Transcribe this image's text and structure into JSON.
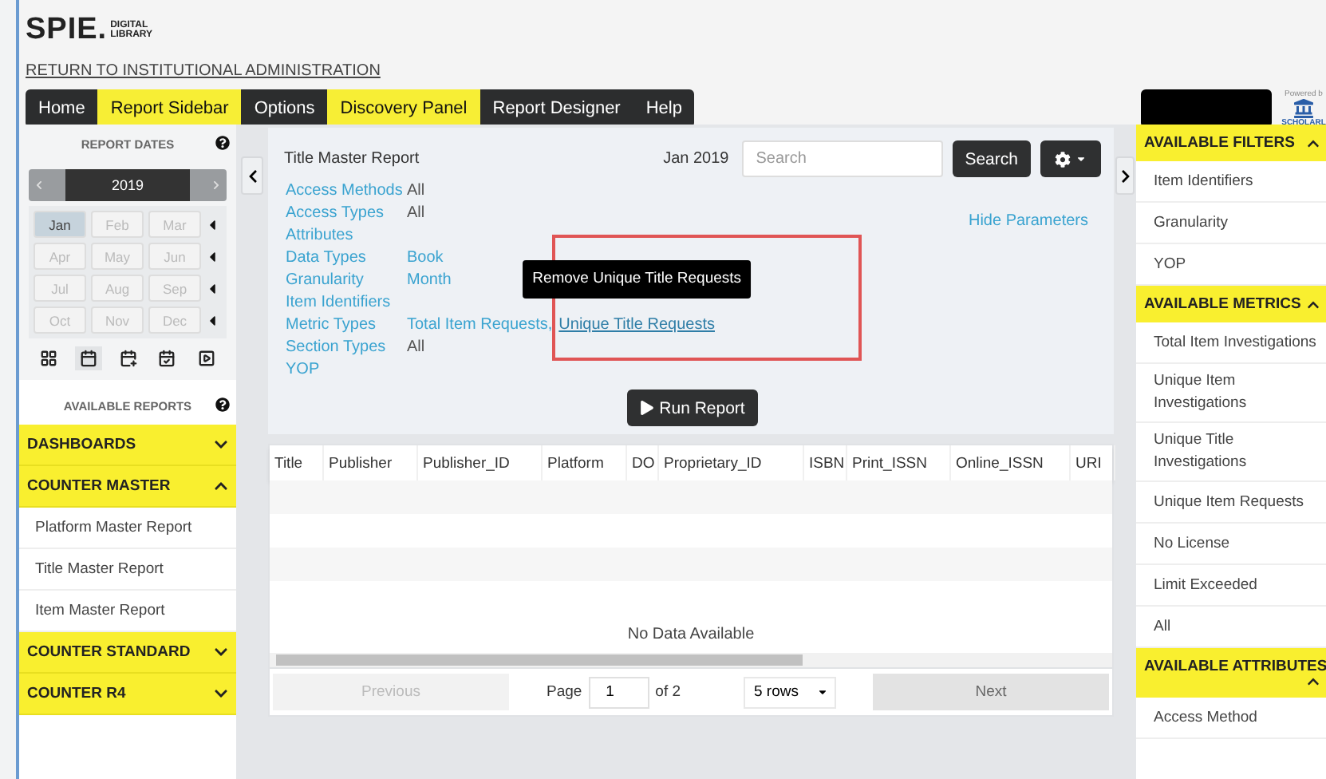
{
  "logo": {
    "name": "SPIE.",
    "sub": [
      "DIGITAL",
      "LIBRARY"
    ]
  },
  "return_link": "RETURN TO INSTITUTIONAL ADMINISTRATION",
  "nav": [
    {
      "label": "Home",
      "highlighted": false
    },
    {
      "label": "Report Sidebar",
      "highlighted": true
    },
    {
      "label": "Options",
      "highlighted": false
    },
    {
      "label": "Discovery Panel",
      "highlighted": true
    },
    {
      "label": "Report Designer",
      "highlighted": false
    },
    {
      "label": "Help",
      "highlighted": false
    }
  ],
  "powered_by": {
    "caption": "Powered b",
    "name": "SCHOLARL"
  },
  "report_dates": {
    "title": "REPORT DATES",
    "year": "2019",
    "months": [
      {
        "label": "Jan",
        "selected": true
      },
      {
        "label": "Feb",
        "selected": false
      },
      {
        "label": "Mar",
        "selected": false
      },
      {
        "label": "Apr",
        "selected": false
      },
      {
        "label": "May",
        "selected": false
      },
      {
        "label": "Jun",
        "selected": false
      },
      {
        "label": "Jul",
        "selected": false
      },
      {
        "label": "Aug",
        "selected": false
      },
      {
        "label": "Sep",
        "selected": false
      },
      {
        "label": "Oct",
        "selected": false
      },
      {
        "label": "Nov",
        "selected": false
      },
      {
        "label": "Dec",
        "selected": false
      }
    ],
    "views": [
      {
        "kind": "grid",
        "selected": false
      },
      {
        "kind": "calendar",
        "selected": true
      },
      {
        "kind": "calendar-plus",
        "selected": false
      },
      {
        "kind": "calendar-check",
        "selected": false
      },
      {
        "kind": "play",
        "selected": false
      }
    ]
  },
  "available_reports": {
    "title": "AVAILABLE REPORTS",
    "groups": [
      {
        "label": "DASHBOARDS",
        "expanded": false
      },
      {
        "label": "COUNTER MASTER",
        "expanded": true,
        "children": [
          {
            "label": "Platform Master Report"
          },
          {
            "label": "Title Master Report"
          },
          {
            "label": "Item Master Report"
          }
        ]
      },
      {
        "label": "COUNTER STANDARD",
        "expanded": false
      },
      {
        "label": "COUNTER R4",
        "expanded": false
      }
    ]
  },
  "report": {
    "title": "Title Master Report",
    "period": "Jan 2019",
    "search": {
      "placeholder": "Search"
    },
    "search_button": "Search",
    "hide_link": "Hide Parameters",
    "parameters": [
      {
        "label": "Access Methods",
        "values": [
          {
            "text": "All",
            "kind": "plain"
          }
        ]
      },
      {
        "label": "Access Types",
        "values": [
          {
            "text": "All",
            "kind": "plain"
          }
        ]
      },
      {
        "label": "Attributes"
      },
      {
        "label": "Data Types",
        "values": [
          {
            "text": "Book",
            "kind": "link"
          }
        ]
      },
      {
        "label": "Granularity",
        "values": [
          {
            "text": "Month",
            "kind": "link"
          }
        ]
      },
      {
        "label": "Item Identifiers"
      },
      {
        "label": "Metric Types",
        "values": [
          {
            "text": "Total Item Requests,",
            "kind": "link"
          },
          {
            "text": "Unique Title Requests",
            "kind": "hovered"
          }
        ]
      },
      {
        "label": "Section Types",
        "values": [
          {
            "text": "All",
            "kind": "plain"
          }
        ]
      },
      {
        "label": "YOP"
      }
    ],
    "tooltip": {
      "text": "Remove Unique Title Requests",
      "highlighted": true
    },
    "run_button": "Run Report"
  },
  "table": {
    "columns": [
      "Title",
      "Publisher",
      "Publisher_ID",
      "Platform",
      "DO",
      "Proprietary_ID",
      "ISBN",
      "Print_ISSN",
      "Online_ISSN",
      "URI"
    ],
    "empty_message": "No Data Available"
  },
  "pagination": {
    "previous": "Previous",
    "page_label": "Page",
    "page": "1",
    "of": "of 2",
    "rows": "5 rows",
    "next": "Next"
  },
  "right_panel": [
    {
      "title": "AVAILABLE FILTERS",
      "expanded": true,
      "items": [
        "Item Identifiers",
        "Granularity",
        "YOP"
      ]
    },
    {
      "title": "AVAILABLE METRICS",
      "expanded": true,
      "items": [
        "Total Item Investigations",
        "Unique Item Investigations",
        "Unique Title Investigations",
        "Unique Item Requests",
        "No License",
        "Limit Exceeded",
        "All"
      ]
    },
    {
      "title": "AVAILABLE ATTRIBUTES",
      "expanded": true,
      "items": [
        "Access Method"
      ]
    }
  ]
}
